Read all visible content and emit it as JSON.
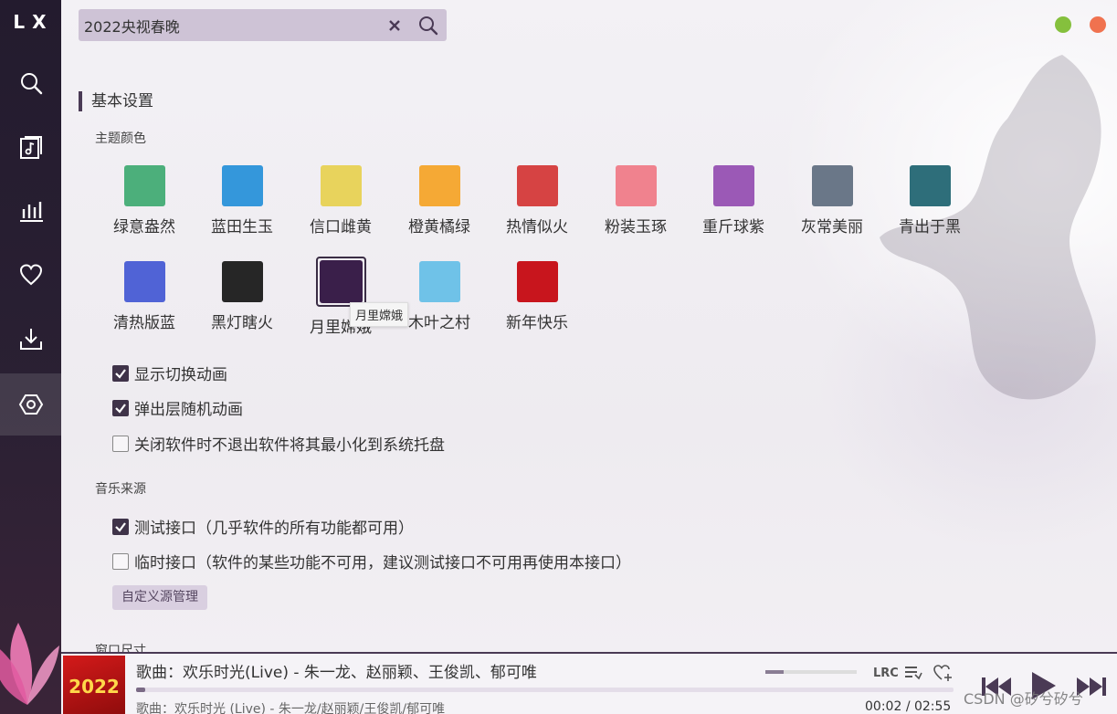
{
  "app": {
    "logo": "LX"
  },
  "search": {
    "value": "2022央视春晚",
    "placeholder": ""
  },
  "sidebar": {
    "items": [
      {
        "name": "search",
        "icon": "search-icon"
      },
      {
        "name": "song-list",
        "icon": "music-list-icon"
      },
      {
        "name": "leaderboard",
        "icon": "bar-chart-icon"
      },
      {
        "name": "favorites",
        "icon": "heart-icon"
      },
      {
        "name": "download",
        "icon": "download-icon"
      },
      {
        "name": "settings",
        "icon": "settings-icon",
        "active": true
      }
    ]
  },
  "window_controls": {
    "minimize_color": "#85c03d",
    "close_color": "#f0724f"
  },
  "settings": {
    "section_title": "基本设置",
    "theme_label": "主题颜色",
    "themes": [
      {
        "name": "绿意盎然",
        "color": "#4caf7b"
      },
      {
        "name": "蓝田生玉",
        "color": "#3497db"
      },
      {
        "name": "信口雌黄",
        "color": "#e8d35c"
      },
      {
        "name": "橙黄橘绿",
        "color": "#f5a935"
      },
      {
        "name": "热情似火",
        "color": "#d64343"
      },
      {
        "name": "粉装玉琢",
        "color": "#f0828e"
      },
      {
        "name": "重斤球紫",
        "color": "#9b59b6"
      },
      {
        "name": "灰常美丽",
        "color": "#6a7788"
      },
      {
        "name": "青出于黑",
        "color": "#2e6e7a"
      },
      {
        "name": "清热版蓝",
        "color": "#5063d6"
      },
      {
        "name": "黑灯瞎火",
        "color": "#262626"
      },
      {
        "name": "月里嫦娥",
        "color": "#3a1f4a",
        "selected": true
      },
      {
        "name": "木叶之村",
        "color": "#6fc2e8"
      },
      {
        "name": "新年快乐",
        "color": "#c8151d"
      }
    ],
    "tooltip": "月里嫦娥",
    "options": [
      {
        "label": "显示切换动画",
        "checked": true
      },
      {
        "label": "弹出层随机动画",
        "checked": true
      },
      {
        "label": "关闭软件时不退出软件将其最小化到系统托盘",
        "checked": false
      }
    ],
    "music_source_label": "音乐来源",
    "sources": [
      {
        "label": "测试接口（几乎软件的所有功能都可用）",
        "checked": true
      },
      {
        "label": "临时接口（软件的某些功能不可用，建议测试接口不可用再使用本接口）",
        "checked": false
      }
    ],
    "custom_source_button": "自定义源管理",
    "window_size_label": "窗口尺寸"
  },
  "player": {
    "cover_text": "2022",
    "title": "歌曲：欢乐时光(Live) - 朱一龙、赵丽颖、王俊凯、郁可唯",
    "subtitle": "歌曲：欢乐时光 (Live) - 朱一龙/赵丽颖/王俊凯/郁可唯",
    "current_time": "00:02",
    "time_separator": "/",
    "total_time": "02:55",
    "progress": 0.011,
    "volume": 0.2,
    "lrc_label": "LRC"
  },
  "watermark": "CSDN @矽兮矽兮"
}
